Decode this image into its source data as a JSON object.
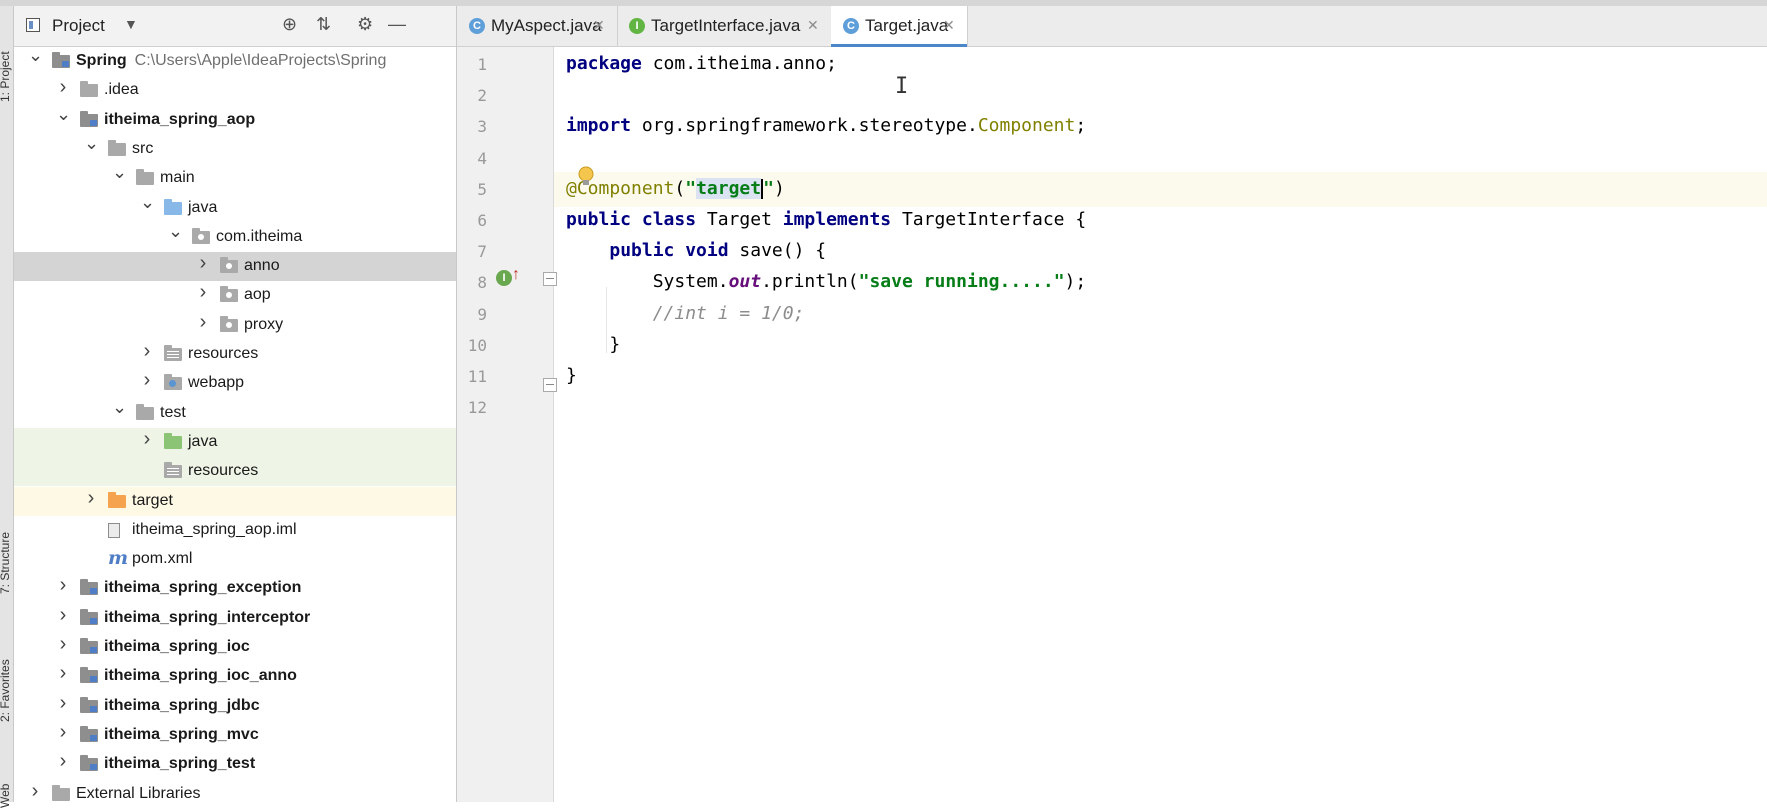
{
  "sidebar_labels": [
    "1: Project",
    "7: Structure",
    "2: Favorites",
    "Web"
  ],
  "project_panel": {
    "title": "Project",
    "tree": [
      {
        "label": "Spring",
        "path": "C:\\Users\\Apple\\IdeaProjects\\Spring",
        "bold": true,
        "icon": "module-folder",
        "arrow": "expanded",
        "level": 0
      },
      {
        "label": ".idea",
        "icon": "folder",
        "arrow": "collapsed",
        "level": 1
      },
      {
        "label": "itheima_spring_aop",
        "bold": true,
        "icon": "module-folder",
        "arrow": "expanded",
        "level": 1
      },
      {
        "label": "src",
        "icon": "folder",
        "arrow": "expanded",
        "level": 2
      },
      {
        "label": "main",
        "icon": "folder",
        "arrow": "expanded",
        "level": 3
      },
      {
        "label": "java",
        "icon": "source-folder",
        "arrow": "expanded",
        "level": 4
      },
      {
        "label": "com.itheima",
        "icon": "package",
        "arrow": "expanded",
        "level": 5
      },
      {
        "label": "anno",
        "icon": "package",
        "arrow": "collapsed",
        "level": 6,
        "selected": true
      },
      {
        "label": "aop",
        "icon": "package",
        "arrow": "collapsed",
        "level": 6
      },
      {
        "label": "proxy",
        "icon": "package",
        "arrow": "collapsed",
        "level": 6
      },
      {
        "label": "resources",
        "icon": "resources-folder",
        "arrow": "collapsed",
        "level": 4
      },
      {
        "label": "webapp",
        "icon": "web-folder",
        "arrow": "collapsed",
        "level": 4
      },
      {
        "label": "test",
        "icon": "folder",
        "arrow": "expanded",
        "level": 3
      },
      {
        "label": "java",
        "icon": "test-folder",
        "arrow": "collapsed",
        "level": 4,
        "tint": "green"
      },
      {
        "label": "resources",
        "icon": "resources-folder",
        "arrow": "none",
        "level": 4,
        "tint": "green"
      },
      {
        "label": "target",
        "icon": "excluded-folder",
        "arrow": "collapsed",
        "level": 2,
        "tint": "yellow"
      },
      {
        "label": "itheima_spring_aop.iml",
        "icon": "iml-file",
        "arrow": "none",
        "level": 2
      },
      {
        "label": "pom.xml",
        "icon": "maven-file",
        "arrow": "none",
        "level": 2
      },
      {
        "label": "itheima_spring_exception",
        "bold": true,
        "icon": "module-folder",
        "arrow": "collapsed",
        "level": 1
      },
      {
        "label": "itheima_spring_interceptor",
        "bold": true,
        "icon": "module-folder",
        "arrow": "collapsed",
        "level": 1
      },
      {
        "label": "itheima_spring_ioc",
        "bold": true,
        "icon": "module-folder",
        "arrow": "collapsed",
        "level": 1
      },
      {
        "label": "itheima_spring_ioc_anno",
        "bold": true,
        "icon": "module-folder",
        "arrow": "collapsed",
        "level": 1
      },
      {
        "label": "itheima_spring_jdbc",
        "bold": true,
        "icon": "module-folder",
        "arrow": "collapsed",
        "level": 1
      },
      {
        "label": "itheima_spring_mvc",
        "bold": true,
        "icon": "module-folder",
        "arrow": "collapsed",
        "level": 1
      },
      {
        "label": "itheima_spring_test",
        "bold": true,
        "icon": "module-folder",
        "arrow": "collapsed",
        "level": 1
      },
      {
        "label": "External Libraries",
        "icon": "library",
        "arrow": "collapsed",
        "level": 0
      }
    ]
  },
  "tabs": [
    {
      "label": "MyAspect.java",
      "icon_letter": "C",
      "icon_color": "#5f9fd9",
      "active": false
    },
    {
      "label": "TargetInterface.java",
      "icon_letter": "I",
      "icon_color": "#62b543",
      "active": false
    },
    {
      "label": "Target.java",
      "icon_letter": "C",
      "icon_color": "#5f9fd9",
      "active": true
    }
  ],
  "editor": {
    "current_line": 5,
    "lines": [
      {
        "n": "1",
        "tokens": [
          {
            "t": "package",
            "c": "kw"
          },
          {
            "t": " com.itheima.anno;",
            "c": ""
          }
        ]
      },
      {
        "n": "2",
        "tokens": []
      },
      {
        "n": "3",
        "tokens": [
          {
            "t": "import",
            "c": "kw"
          },
          {
            "t": " org.springframework.stereotype.",
            "c": ""
          },
          {
            "t": "Component",
            "c": "cls"
          },
          {
            "t": ";",
            "c": ""
          }
        ]
      },
      {
        "n": "4",
        "tokens": []
      },
      {
        "n": "5",
        "tokens": [
          {
            "t": "@Component",
            "c": "ann"
          },
          {
            "t": "(",
            "c": ""
          },
          {
            "t": "\"",
            "c": "str"
          },
          {
            "t": "target",
            "c": "str hl"
          },
          {
            "t": "|",
            "c": "caret"
          },
          {
            "t": "\"",
            "c": "str"
          },
          {
            "t": ")",
            "c": ""
          }
        ]
      },
      {
        "n": "6",
        "tokens": [
          {
            "t": "public class",
            "c": "kw"
          },
          {
            "t": " Target ",
            "c": ""
          },
          {
            "t": "implements",
            "c": "kw"
          },
          {
            "t": " TargetInterface {",
            "c": ""
          }
        ]
      },
      {
        "n": "7",
        "tokens": [
          {
            "t": "    ",
            "c": ""
          },
          {
            "t": "public void",
            "c": "kw"
          },
          {
            "t": " save() {",
            "c": ""
          }
        ]
      },
      {
        "n": "8",
        "tokens": [
          {
            "t": "        System.",
            "c": ""
          },
          {
            "t": "out",
            "c": "fld"
          },
          {
            "t": ".println(",
            "c": ""
          },
          {
            "t": "\"save running.....\"",
            "c": "str"
          },
          {
            "t": ");",
            "c": ""
          }
        ]
      },
      {
        "n": "9",
        "tokens": [
          {
            "t": "        ",
            "c": ""
          },
          {
            "t": "//int i = 1/0;",
            "c": "cmt"
          }
        ]
      },
      {
        "n": "10",
        "tokens": [
          {
            "t": "    }",
            "c": ""
          }
        ]
      },
      {
        "n": "11",
        "tokens": [
          {
            "t": "}",
            "c": ""
          }
        ]
      },
      {
        "n": "12",
        "tokens": []
      }
    ]
  }
}
